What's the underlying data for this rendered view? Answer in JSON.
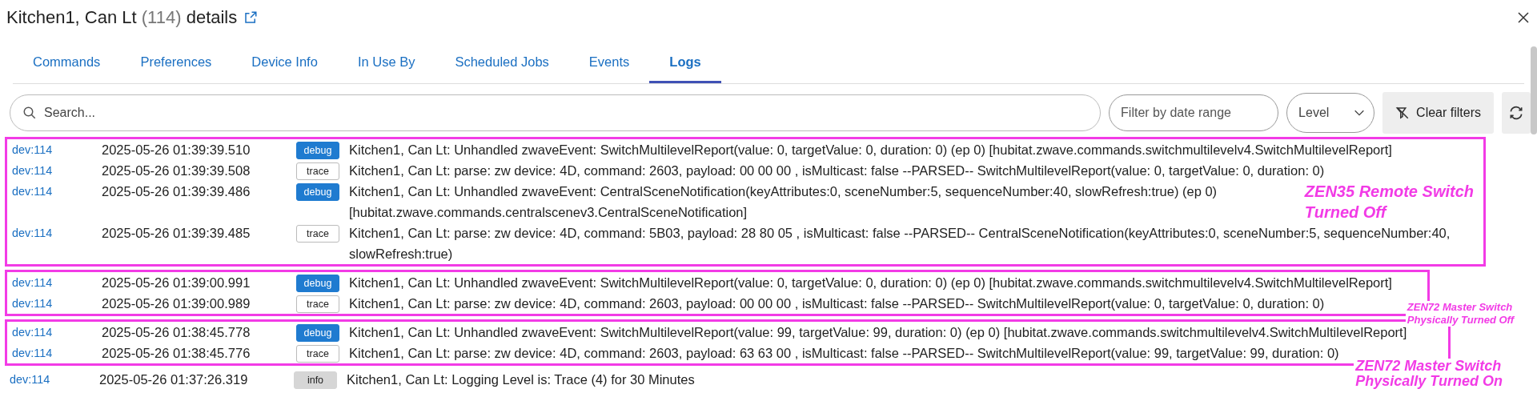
{
  "header": {
    "name": "Kitchen1, Can Lt",
    "device_id": "(114)",
    "suffix": "details"
  },
  "tabs": [
    {
      "label": "Commands",
      "selected": false
    },
    {
      "label": "Preferences",
      "selected": false
    },
    {
      "label": "Device Info",
      "selected": false
    },
    {
      "label": "In Use By",
      "selected": false
    },
    {
      "label": "Scheduled Jobs",
      "selected": false
    },
    {
      "label": "Events",
      "selected": false
    },
    {
      "label": "Logs",
      "selected": true
    }
  ],
  "filters": {
    "search_placeholder": "Search...",
    "date_placeholder": "Filter by date range",
    "level_select": "Level",
    "clear_button": "Clear filters"
  },
  "log_groups": [
    {
      "annotation": {
        "lines": [
          "ZEN35 Remote Switch",
          "Turned Off"
        ]
      },
      "rows": [
        {
          "source": "dev:114",
          "time": "2025-05-26 01:39:39.510",
          "level": "debug",
          "kind": "debug",
          "message": "Kitchen1, Can Lt: Unhandled zwaveEvent: SwitchMultilevelReport(value: 0, targetValue: 0, duration: 0) (ep 0) [hubitat.zwave.commands.switchmultilevelv4.SwitchMultilevelReport]"
        },
        {
          "source": "dev:114",
          "time": "2025-05-26 01:39:39.508",
          "level": "trace",
          "kind": "trace",
          "message": "Kitchen1, Can Lt: parse: zw device: 4D, command: 2603, payload: 00 00 00 , isMulticast: false --PARSED-- SwitchMultilevelReport(value: 0, targetValue: 0, duration: 0)"
        },
        {
          "source": "dev:114",
          "time": "2025-05-26 01:39:39.486",
          "level": "debug",
          "kind": "debug",
          "message": "Kitchen1, Can Lt: Unhandled zwaveEvent: CentralSceneNotification(keyAttributes:0, sceneNumber:5, sequenceNumber:40, slowRefresh:true) (ep 0) [hubitat.zwave.commands.centralscenev3.CentralSceneNotification]"
        },
        {
          "source": "dev:114",
          "time": "2025-05-26 01:39:39.485",
          "level": "trace",
          "kind": "trace",
          "message": "Kitchen1, Can Lt: parse: zw device: 4D, command: 5B03, payload: 28 80 05 , isMulticast: false --PARSED-- CentralSceneNotification(keyAttributes:0, sceneNumber:5, sequenceNumber:40, slowRefresh:true)"
        }
      ]
    },
    {
      "annotation": {
        "lines": [
          "ZEN72 Master Switch",
          "Physically Turned Off"
        ]
      },
      "rows": [
        {
          "source": "dev:114",
          "time": "2025-05-26 01:39:00.991",
          "level": "debug",
          "kind": "debug",
          "message": "Kitchen1, Can Lt: Unhandled zwaveEvent: SwitchMultilevelReport(value: 0, targetValue: 0, duration: 0) (ep 0) [hubitat.zwave.commands.switchmultilevelv4.SwitchMultilevelReport]"
        },
        {
          "source": "dev:114",
          "time": "2025-05-26 01:39:00.989",
          "level": "trace",
          "kind": "trace",
          "message": "Kitchen1, Can Lt: parse: zw device: 4D, command: 2603, payload: 00 00 00 , isMulticast: false --PARSED-- SwitchMultilevelReport(value: 0, targetValue: 0, duration: 0)"
        }
      ]
    },
    {
      "annotation": {
        "lines": [
          "ZEN72 Master Switch",
          "Physically Turned On"
        ]
      },
      "rows": [
        {
          "source": "dev:114",
          "time": "2025-05-26 01:38:45.778",
          "level": "debug",
          "kind": "debug",
          "message": "Kitchen1, Can Lt: Unhandled zwaveEvent: SwitchMultilevelReport(value: 99, targetValue: 99, duration: 0) (ep 0) [hubitat.zwave.commands.switchmultilevelv4.SwitchMultilevelReport]"
        },
        {
          "source": "dev:114",
          "time": "2025-05-26 01:38:45.776",
          "level": "trace",
          "kind": "trace",
          "message": "Kitchen1, Can Lt: parse: zw device: 4D, command: 2603, payload: 63 63 00 , isMulticast: false --PARSED-- SwitchMultilevelReport(value: 99, targetValue: 99, duration: 0)"
        }
      ]
    }
  ],
  "ungrouped_rows": [
    {
      "source": "dev:114",
      "time": "2025-05-26 01:37:26.319",
      "level": "info",
      "kind": "info",
      "message": "Kitchen1, Can Lt: Logging Level is: Trace (4) for 30 Minutes"
    }
  ]
}
